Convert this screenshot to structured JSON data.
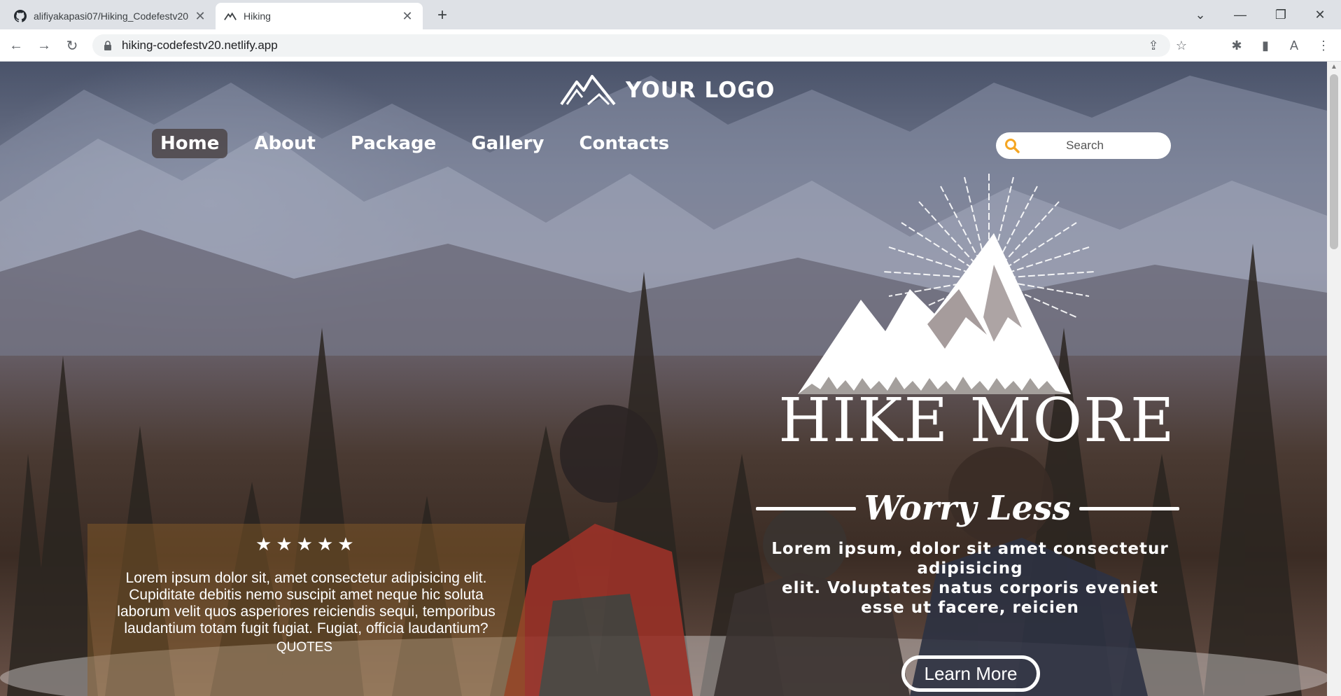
{
  "browser": {
    "tabs": [
      {
        "title": "alifiyakapasi07/Hiking_Codefestv20",
        "icon": "github-icon",
        "active": false
      },
      {
        "title": "Hiking",
        "icon": "mountain-icon",
        "active": true
      }
    ],
    "url": "hiking-codefestv20.netlify.app"
  },
  "site": {
    "logo_text": "YOUR LOGO",
    "nav": [
      {
        "label": "Home",
        "active": true
      },
      {
        "label": "About",
        "active": false
      },
      {
        "label": "Package",
        "active": false
      },
      {
        "label": "Gallery",
        "active": false
      },
      {
        "label": "Contacts",
        "active": false
      }
    ],
    "search": {
      "placeholder": "Search"
    },
    "hero": {
      "title": "HIKE MORE",
      "script": "Worry Less",
      "body_lines": [
        "Lorem ipsum, dolor sit amet consectetur adipisicing",
        "elit. Voluptates natus corporis eveniet",
        "esse ut facere, reicien"
      ],
      "cta": "Learn More"
    },
    "testimonial": {
      "stars": 5,
      "text_lines": [
        "Lorem ipsum dolor sit, amet consectetur adipisicing elit.",
        "Cupiditate debitis nemo suscipit amet neque hic soluta",
        "laborum velit quos asperiores reiciendis sequi, temporibus",
        "laudantium totam fugit fugiat. Fugiat, officia laudantium?"
      ],
      "label": "QUOTES"
    }
  },
  "colors": {
    "search_icon": "#f5a623",
    "card_bg": "#8c5f28",
    "chrome_bg": "#dee1e6"
  }
}
